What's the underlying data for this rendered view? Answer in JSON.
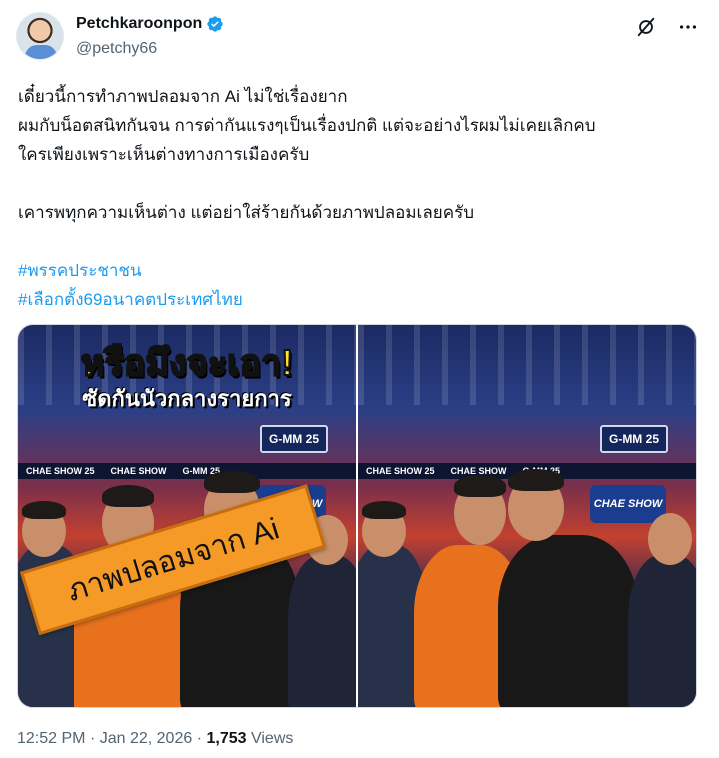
{
  "author": {
    "display_name": "Petchkaroonpon",
    "handle": "@petchy66",
    "verified_badge_color": "#1d9bf0"
  },
  "icons": {
    "top_right": [
      "grok-icon",
      "more-icon"
    ]
  },
  "post": {
    "lines": [
      "เดี๋ยวนี้การทำภาพปลอมจาก Ai ไม่ใช่เรื่องยาก",
      "ผมกับน็อตสนิทกันจน การด่ากันแรงๆเป็นเรื่องปกติ แต่จะอย่างไรผมไม่เคยเลิกคบ",
      "ใครเพียงเพราะเห็นต่างทางการเมืองครับ"
    ],
    "line4": "เคารพทุกความเห็นต่าง แต่อย่าใส่ร้ายกันด้วยภาพปลอมเลยครับ",
    "hashtags": [
      "#พรรคประชาชน",
      "#เลือกตั้ง69อนาคตประเทศไทย"
    ],
    "link_color": "#1d9bf0"
  },
  "media": {
    "left": {
      "headline": "หรือมึงจะเอา!",
      "subheadline": "ซัดกันนัวกลางรายการ",
      "screen_label": "G-MM 25",
      "banner": [
        "CHAE SHOW 25",
        "CHAE SHOW",
        "G-MM 25"
      ],
      "show_logo": "CHAE SHOW",
      "stamp_text": "ภาพปลอมจาก Ai",
      "stamp_color": "#f59a26"
    },
    "right": {
      "screen_label": "G-MM 25",
      "banner": [
        "CHAE SHOW 25",
        "CHAE SHOW",
        "G-MM 25"
      ],
      "show_logo": "CHAE SHOW"
    }
  },
  "meta": {
    "time": "12:52 PM",
    "separator": "·",
    "date": "Jan 22, 2026",
    "views_count": "1,753",
    "views_label": "Views"
  }
}
